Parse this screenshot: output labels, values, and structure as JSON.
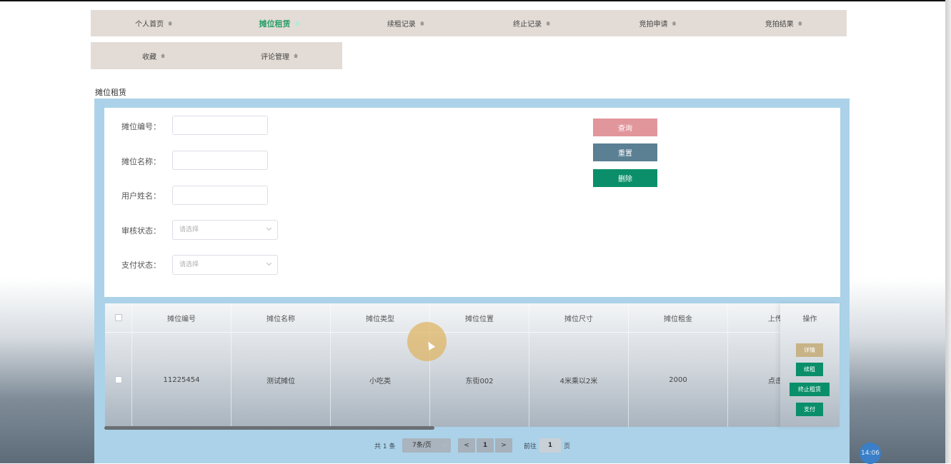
{
  "nav": {
    "row1": [
      {
        "label": "个人首页",
        "active": false
      },
      {
        "label": "摊位租赁",
        "active": true
      },
      {
        "label": "续租记录",
        "active": false
      },
      {
        "label": "终止记录",
        "active": false
      },
      {
        "label": "竞拍申请",
        "active": false
      },
      {
        "label": "竞拍结果",
        "active": false
      }
    ],
    "row2": [
      {
        "label": "收藏"
      },
      {
        "label": "评论管理"
      }
    ]
  },
  "page_title": "摊位租赁",
  "search": {
    "stall_no_label": "摊位编号：",
    "stall_name_label": "摊位名称：",
    "user_name_label": "用户姓名：",
    "audit_status_label": "审核状态：",
    "audit_status_placeholder": "请选择",
    "pay_status_label": "支付状态：",
    "pay_status_placeholder": "请选择",
    "query_button": "查询",
    "reset_button": "重置",
    "delete_button": "删除"
  },
  "table": {
    "columns": [
      "摊位编号",
      "摊位名称",
      "摊位类型",
      "摊位位置",
      "摊位尺寸",
      "摊位租金",
      "上传",
      "操作"
    ],
    "rows": [
      {
        "stall_no": "11225454",
        "stall_name": "测试摊位",
        "type": "小吃类",
        "location": "东街002",
        "size": "4米乘以2米",
        "rent": "2000",
        "upload": "点击"
      }
    ],
    "actions": [
      "详情",
      "续租",
      "终止租赁",
      "支付"
    ]
  },
  "pagination": {
    "total": "共 1 条",
    "page_size": "7条/页",
    "prev": "<",
    "current": "1",
    "next": ">",
    "goto_label": "前往",
    "goto_value": "1",
    "page_suffix": "页"
  },
  "clock": "14:06",
  "colors": {
    "nav_bg": "#e3dcd6",
    "frame": "#abd2e8",
    "query": "#e1969c",
    "reset": "#5b7f93",
    "delete": "#0a8f6a",
    "detail": "#c7b386",
    "renew": "#0a8f6a"
  }
}
